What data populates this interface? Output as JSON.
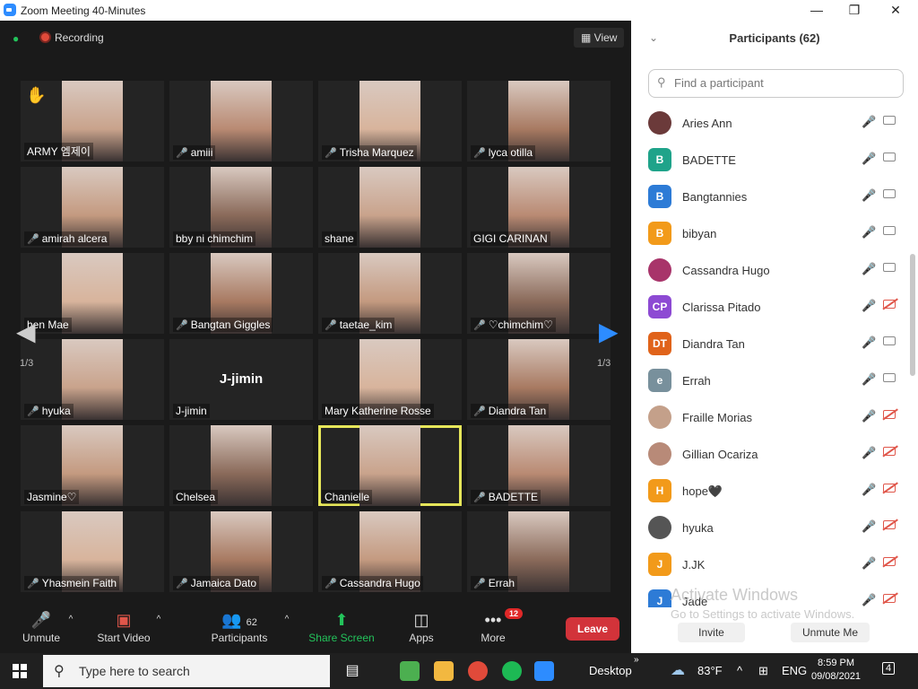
{
  "window": {
    "title": "Zoom Meeting 40-Minutes"
  },
  "topbar": {
    "recording": "Recording",
    "view": "View"
  },
  "tiles": [
    {
      "name": "ARMY 엠제이",
      "muted": false,
      "hand": true
    },
    {
      "name": "amiii",
      "muted": true
    },
    {
      "name": "Trisha Marquez",
      "muted": true
    },
    {
      "name": "lyca otilla",
      "muted": true
    },
    {
      "name": "amirah alcera",
      "muted": true
    },
    {
      "name": "bby ni chimchim",
      "muted": false
    },
    {
      "name": "shane",
      "muted": false
    },
    {
      "name": "GIGI CARINAN",
      "muted": false
    },
    {
      "name": "hen Mae",
      "muted": false
    },
    {
      "name": "Bangtan Giggles",
      "muted": true
    },
    {
      "name": "taetae_kim",
      "muted": true
    },
    {
      "name": "♡chimchim♡",
      "muted": true
    },
    {
      "name": "hyuka",
      "muted": true
    },
    {
      "name": "J-jimin",
      "muted": false,
      "center": "J-jimin"
    },
    {
      "name": "Mary Katherine Rosse",
      "muted": false
    },
    {
      "name": "Diandra Tan",
      "muted": true
    },
    {
      "name": "Jasmine♡",
      "muted": false
    },
    {
      "name": "Chelsea",
      "muted": false
    },
    {
      "name": "Chanielle",
      "muted": false,
      "active": true
    },
    {
      "name": "BADETTE",
      "muted": true
    },
    {
      "name": "Yhasmein Faith",
      "muted": true
    },
    {
      "name": "Jamaica Dato",
      "muted": true
    },
    {
      "name": "Cassandra Hugo",
      "muted": true
    },
    {
      "name": "Errah",
      "muted": true
    }
  ],
  "pager": {
    "left": "1/3",
    "right": "1/3"
  },
  "toolbar": {
    "unmute": "Unmute",
    "start_video": "Start Video",
    "participants": "Participants",
    "participants_count": "62",
    "share_screen": "Share Screen",
    "apps": "Apps",
    "more": "More",
    "more_badge": "12",
    "leave": "Leave"
  },
  "panel": {
    "title": "Participants (62)",
    "search_placeholder": "Find a participant",
    "invite": "Invite",
    "unmute_me": "Unmute Me",
    "watermark_title": "Activate Windows",
    "watermark_sub": "Go to Settings to activate Windows.",
    "participants": [
      {
        "name": "Aries Ann",
        "initials": "",
        "color": "#6b3a3a",
        "cam_off": false
      },
      {
        "name": "BADETTE",
        "initials": "B",
        "color": "#1fa38a",
        "cam_off": false
      },
      {
        "name": "Bangtannies",
        "initials": "B",
        "color": "#2d7bd6",
        "cam_off": false
      },
      {
        "name": "bibyan",
        "initials": "B",
        "color": "#f29a1a",
        "cam_off": false
      },
      {
        "name": "Cassandra Hugo",
        "initials": "",
        "color": "#a8346a",
        "cam_off": false
      },
      {
        "name": "Clarissa Pitado",
        "initials": "CP",
        "color": "#8d4ad3",
        "cam_off": true
      },
      {
        "name": "Diandra Tan",
        "initials": "DT",
        "color": "#e0631a",
        "cam_off": false
      },
      {
        "name": "Errah",
        "initials": "e",
        "color": "#78909c",
        "cam_off": false
      },
      {
        "name": "Fraille Morias",
        "initials": "",
        "color": "#c4a08a",
        "cam_off": true
      },
      {
        "name": "Gillian Ocariza",
        "initials": "",
        "color": "#b88a78",
        "cam_off": true
      },
      {
        "name": "hope🖤",
        "initials": "H",
        "color": "#f29a1a",
        "cam_off": true
      },
      {
        "name": "hyuka",
        "initials": "",
        "color": "#555",
        "cam_off": true
      },
      {
        "name": "J.JK",
        "initials": "J",
        "color": "#f29a1a",
        "cam_off": true
      },
      {
        "name": "Jade",
        "initials": "J",
        "color": "#2d7bd6",
        "cam_off": true
      }
    ]
  },
  "taskbar": {
    "search": "Type here to search",
    "desktop": "Desktop",
    "temp": "83°F",
    "lang": "ENG",
    "time": "8:59 PM",
    "date": "09/08/2021",
    "notif": "4"
  },
  "colors": {
    "accent": "#2d8cff",
    "leave": "#d2333a",
    "muted": "#e0564a",
    "share": "#23c35b"
  }
}
